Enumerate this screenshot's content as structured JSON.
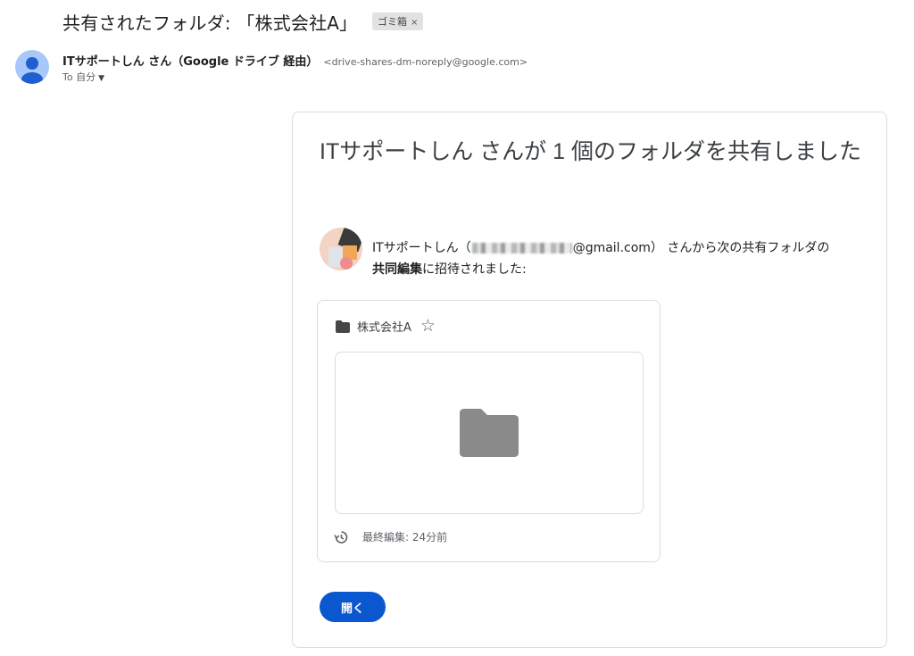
{
  "email": {
    "subject": "共有されたフォルダ: 「株式会社A」",
    "label": "ゴミ箱",
    "label_close": "×",
    "sender_name": "ITサポートしん さん（Google ドライブ 経由）",
    "sender_email": "<drive-shares-dm-noreply@google.com>",
    "to_label": "To 自分",
    "to_caret": "▼"
  },
  "card": {
    "headline": "ITサポートしん さんが 1 個のフォルダを共有しました",
    "invite_prefix": "ITサポートしん（",
    "invite_email_suffix": "@gmail.com）",
    "invite_mid": " さんから次の共有フォルダの",
    "invite_role": "共同編集",
    "invite_suffix": "に招待されました:",
    "folder_name": "株式会社A",
    "star": "☆",
    "modified": "最終編集: 24分前",
    "open_button": "開く"
  },
  "colors": {
    "accent": "#0b57d0",
    "avatar_bg": "#a8c7fa",
    "avatar_fg": "#1f5fd1"
  },
  "icons": {
    "sender_avatar": "person-icon",
    "folder": "folder-icon",
    "star": "star-outline-icon",
    "history": "history-icon"
  }
}
